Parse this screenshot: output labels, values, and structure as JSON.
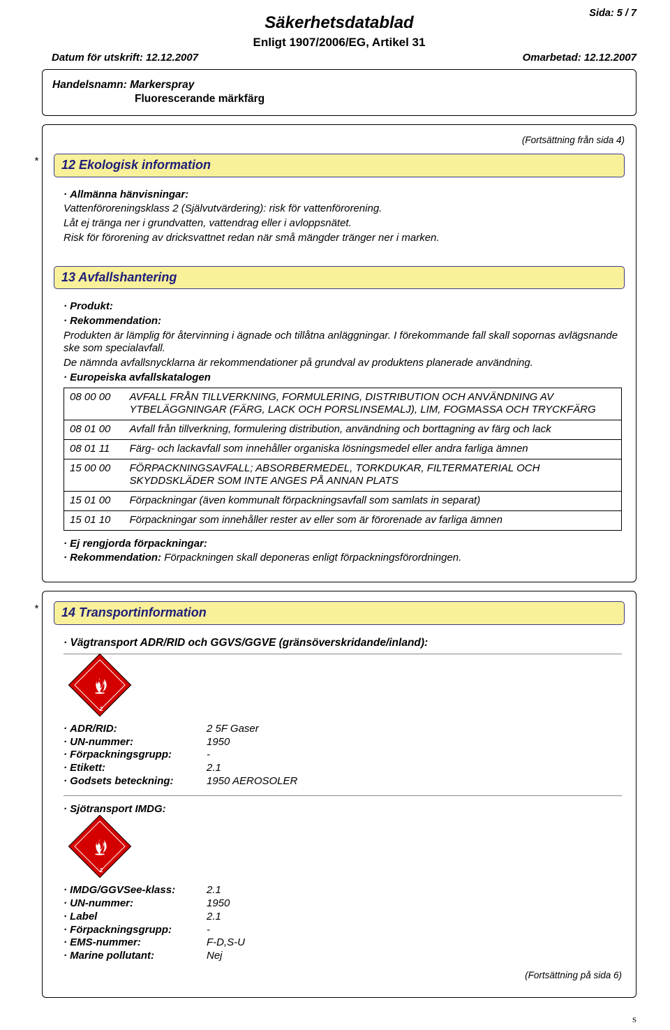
{
  "header": {
    "page_indicator": "Sida: 5 / 7",
    "title": "Säkerhetsdatablad",
    "subtitle": "Enligt 1907/2006/EG, Artikel 31",
    "print_date": "Datum för utskrift: 12.12.2007",
    "revised": "Omarbetad: 12.12.2007",
    "trade_name_label": "Handelsnamn:",
    "trade_name_value": "Markerspray",
    "trade_name_sub": "Fluorescerande märkfärg",
    "continuation_from": "(Fortsättning från sida 4)",
    "continuation_to": "(Fortsättning på sida 6)",
    "s_mark": "S"
  },
  "section12": {
    "title": "12 Ekologisk information",
    "general_label": "Allmänna hänvisningar:",
    "line1": "Vattenföroreningsklass 2 (Självutvärdering): risk för vattenförorening.",
    "line2": "Låt ej tränga ner i grundvatten, vattendrag eller i avloppsnätet.",
    "line3": "Risk för förorening av dricksvattnet redan när små mängder tränger ner i marken."
  },
  "section13": {
    "title": "13 Avfallshantering",
    "product_label": "Produkt:",
    "recommend_label": "Rekommendation:",
    "para1": "Produkten är lämplig för återvinning i ägnade och tillåtna anläggningar. I förekommande fall skall sopornas avlägsnande ske som specialavfall.",
    "para2": "De nämnda avfallsnycklarna är rekommendationer på grundval av produktens planerade användning.",
    "catalog_label": "Europeiska avfallskatalogen",
    "catalog": [
      {
        "code": "08 00 00",
        "text": "AVFALL FRÅN TILLVERKNING, FORMULERING, DISTRIBUTION OCH ANVÄNDNING AV YTBELÄGGNINGAR (FÄRG, LACK OCH PORSLINSEMALJ), LIM, FOGMASSA OCH TRYCKFÄRG"
      },
      {
        "code": "08 01 00",
        "text": "Avfall från tillverkning, formulering distribution, användning och borttagning av färg och lack"
      },
      {
        "code": "08 01 11",
        "text": "Färg- och lackavfall som innehåller organiska lösningsmedel eller andra farliga ämnen"
      },
      {
        "code": "15 00 00",
        "text": "FÖRPACKNINGSAVFALL; ABSORBERMEDEL, TORKDUKAR, FILTERMATERIAL OCH SKYDDSKLÄDER SOM INTE ANGES PÅ ANNAN PLATS"
      },
      {
        "code": "15 01 00",
        "text": "Förpackningar (även kommunalt förpackningsavfall som samlats in separat)"
      },
      {
        "code": "15 01 10",
        "text": "Förpackningar som innehåller rester av eller som är förorenade av farliga ämnen"
      }
    ],
    "uncleaned_label": "Ej rengjorda förpackningar:",
    "uncleaned_rec_label": "Rekommendation:",
    "uncleaned_rec_text": "Förpackningen skall deponeras enligt förpackningsförordningen."
  },
  "section14": {
    "title": "14 Transportinformation",
    "road_head": "Vägtransport ADR/RID och GGVS/GGVE (gränsöverskridande/inland):",
    "hazard_number": "2",
    "road": [
      {
        "label": "ADR/RID:",
        "value": "2   5F Gaser"
      },
      {
        "label": "UN-nummer:",
        "value": "1950"
      },
      {
        "label": "Förpackningsgrupp:",
        "value": "-"
      },
      {
        "label": "Etikett:",
        "value": "2.1"
      },
      {
        "label": "Godsets beteckning:",
        "value": "1950 AEROSOLER"
      }
    ],
    "sea_head": "Sjötransport IMDG:",
    "sea": [
      {
        "label": "IMDG/GGVSee-klass:",
        "value": "2.1"
      },
      {
        "label": "UN-nummer:",
        "value": "1950"
      },
      {
        "label": "Label",
        "value": "2.1"
      },
      {
        "label": "Förpackningsgrupp:",
        "value": "-"
      },
      {
        "label": "EMS-nummer:",
        "value": "F-D,S-U"
      },
      {
        "label": "Marine pollutant:",
        "value": "Nej"
      }
    ]
  }
}
